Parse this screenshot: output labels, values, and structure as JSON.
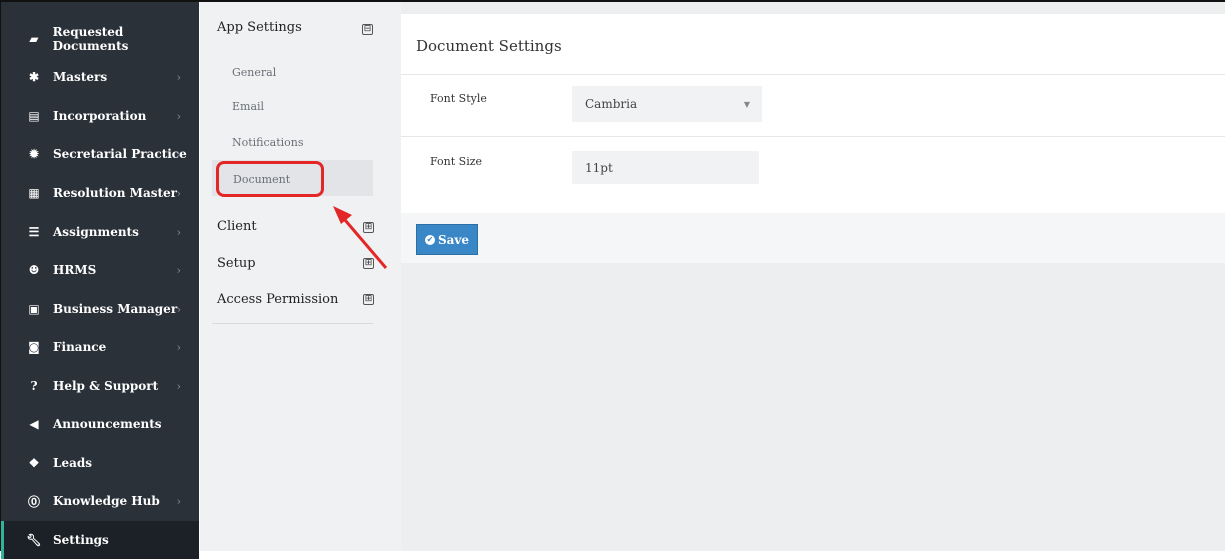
{
  "sidebar": {
    "items": [
      {
        "label": "Requested Documents",
        "icon": "book-icon"
      },
      {
        "label": "Masters",
        "icon": "asterisk-icon"
      },
      {
        "label": "Incorporation",
        "icon": "file-icon"
      },
      {
        "label": "Secretarial Practice",
        "icon": "gear-icon"
      },
      {
        "label": "Resolution Master",
        "icon": "grid-icon"
      },
      {
        "label": "Assignments",
        "icon": "tasks-icon"
      },
      {
        "label": "HRMS",
        "icon": "users-icon"
      },
      {
        "label": "Business Manager",
        "icon": "film-icon"
      },
      {
        "label": "Finance",
        "icon": "money-icon"
      },
      {
        "label": "Help & Support",
        "icon": "question-icon"
      },
      {
        "label": "Announcements",
        "icon": "megaphone-icon"
      },
      {
        "label": "Leads",
        "icon": "cubes-icon"
      },
      {
        "label": "Knowledge Hub",
        "icon": "circle-question-icon"
      },
      {
        "label": "Settings",
        "icon": "wrench-icon"
      }
    ],
    "active_color": "#2fb39b"
  },
  "settings_menu": {
    "app_settings": "App Settings",
    "app_settings_toggle": "⊟",
    "subitems": [
      "General",
      "Email",
      "Notifications",
      "Document"
    ],
    "client": "Client",
    "setup": "Setup",
    "access_permission": "Access Permission",
    "expand_symbol": "⊞"
  },
  "document_settings": {
    "title": "Document Settings",
    "font_style_label": "Font Style",
    "font_style_value": "Cambria",
    "font_size_label": "Font Size",
    "font_size_value": "11pt",
    "save_label": "Save"
  },
  "colors": {
    "highlight": "#e32726",
    "save_button": "#3a87c8",
    "sidebar": "#2b3139"
  }
}
